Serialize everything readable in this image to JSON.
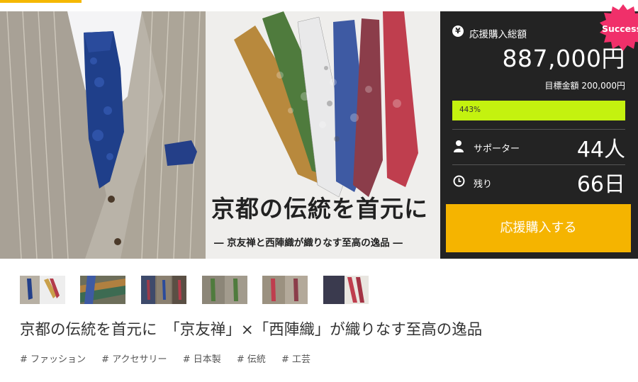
{
  "hero": {
    "title": "京都の伝統を首元に",
    "subtitle": "― 京友禅と西陣織が織りなす至高の逸品 ―"
  },
  "panel": {
    "badge": "Success",
    "total_label": "応援購入総額",
    "total_amount": "887,000円",
    "goal": "目標金額 200,000円",
    "progress_label": "443%",
    "progress_percent": 443,
    "supporters_label": "サポーター",
    "supporters_value": "44人",
    "remaining_label": "残り",
    "remaining_value": "66日",
    "button_label": "応援購入する"
  },
  "icons": {
    "yen": "¥",
    "supporters": "person-icon",
    "remaining": "clock-icon"
  },
  "colors": {
    "accent": "#f5b400",
    "panel_bg": "#232323",
    "progress": "#c4f20f",
    "badge": "#f0306a"
  },
  "project": {
    "title": "京都の伝統を首元に　「京友禅」×「西陣織」が織りなす至高の逸品",
    "tags": [
      "# ファッション",
      "# アクセサリー",
      "# 日本製",
      "# 伝統",
      "# 工芸"
    ]
  }
}
